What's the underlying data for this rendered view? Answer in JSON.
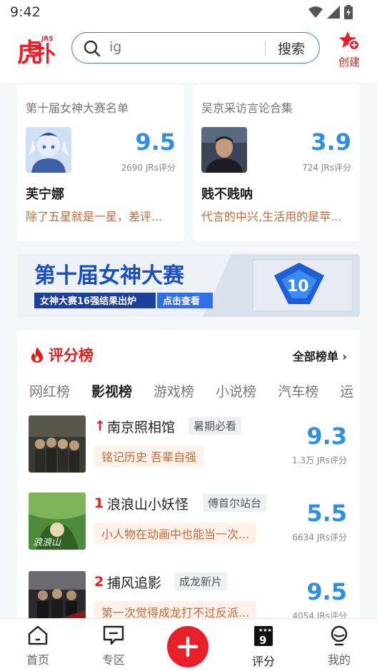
{
  "status": {
    "time": "9:42"
  },
  "header": {
    "logo_icon": "hupu-logo",
    "logo_text": "JRS",
    "search_placeholder": "ig",
    "search_button": "搜索",
    "create_label": "创建"
  },
  "cards": [
    {
      "title": "第十届女神大赛名单",
      "score": "9.5",
      "count": "2690 JRs评分",
      "name": "芙宁娜",
      "desc": "除了五星就是一星，差评..."
    },
    {
      "title": "吴京采访言论合集",
      "score": "3.9",
      "count": "724 JRs评分",
      "name": "贱不贱呐",
      "desc": "代言的中兴,生活用的是苹..."
    }
  ],
  "banner": {
    "title": "第十届女神大赛",
    "subtitle": "女神大赛16强结果出炉",
    "cta": "点击查看"
  },
  "ranking": {
    "title": "评分榜",
    "all_label": "全部榜单",
    "tabs": [
      "网红榜",
      "影视榜",
      "游戏榜",
      "小说榜",
      "汽车榜",
      "运"
    ],
    "active_tab": "影视榜",
    "items": [
      {
        "rank": "↑",
        "name": "南京照相馆",
        "tag": "暑期必看",
        "quote": "铭记历史 吾辈自强",
        "score": "9.3",
        "count": "1.3万 JRs评分"
      },
      {
        "rank": "1",
        "name": "浪浪山小妖怪",
        "tag": "傅首尔站台",
        "quote": "小人物在动画中也能当一次...",
        "score": "5.5",
        "count": "6634 JRs评分"
      },
      {
        "rank": "2",
        "name": "捕风追影",
        "tag": "成龙新片",
        "quote": "第一次觉得成龙打不过反派...",
        "score": "9.5",
        "count": "4054 JRs评分"
      }
    ]
  },
  "tabbar": {
    "items": [
      {
        "label": "首页",
        "icon": "home-icon"
      },
      {
        "label": "专区",
        "icon": "chat-icon"
      },
      {
        "label": "",
        "icon": "plus-icon"
      },
      {
        "label": "评分",
        "icon": "rating-icon",
        "badge": "9"
      },
      {
        "label": "我的",
        "icon": "profile-icon"
      }
    ]
  },
  "colors": {
    "brand_red": "#e8202a",
    "score_blue": "#2f8fe0",
    "quote_brown": "#c06a3a"
  }
}
